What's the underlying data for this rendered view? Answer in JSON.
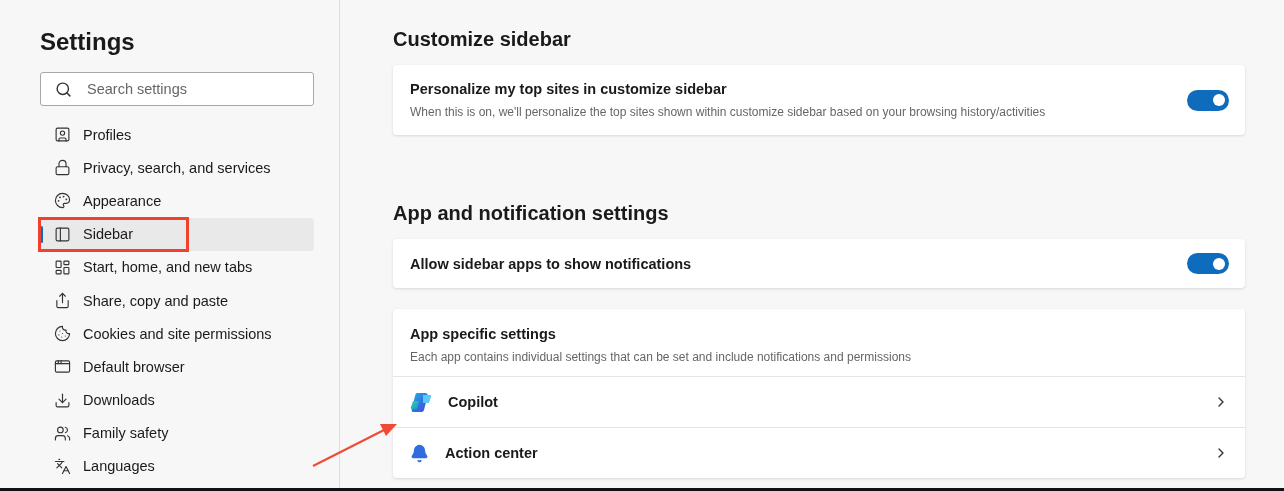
{
  "sidebar": {
    "title": "Settings",
    "search": {
      "placeholder": "Search settings"
    },
    "items": [
      {
        "label": "Profiles",
        "selected": false
      },
      {
        "label": "Privacy, search, and services",
        "selected": false
      },
      {
        "label": "Appearance",
        "selected": false
      },
      {
        "label": "Sidebar",
        "selected": true
      },
      {
        "label": "Start, home, and new tabs",
        "selected": false
      },
      {
        "label": "Share, copy and paste",
        "selected": false
      },
      {
        "label": "Cookies and site permissions",
        "selected": false
      },
      {
        "label": "Default browser",
        "selected": false
      },
      {
        "label": "Downloads",
        "selected": false
      },
      {
        "label": "Family safety",
        "selected": false
      },
      {
        "label": "Languages",
        "selected": false
      }
    ]
  },
  "sections": [
    {
      "title": "Customize sidebar",
      "cards": [
        {
          "kind": "toggle",
          "title": "Personalize my top sites in customize sidebar",
          "description": "When this is on, we'll personalize the top sites shown within customize sidebar based on your browsing history/activities",
          "on": true
        }
      ]
    },
    {
      "title": "App and notification settings",
      "cards": [
        {
          "kind": "toggle",
          "title": "Allow sidebar apps to show notifications",
          "on": true
        },
        {
          "kind": "list",
          "title": "App specific settings",
          "description": "Each app contains individual settings that can be set and include notifications and permissions",
          "apps": [
            {
              "name": "Copilot"
            },
            {
              "name": "Action center"
            }
          ]
        }
      ]
    }
  ]
}
